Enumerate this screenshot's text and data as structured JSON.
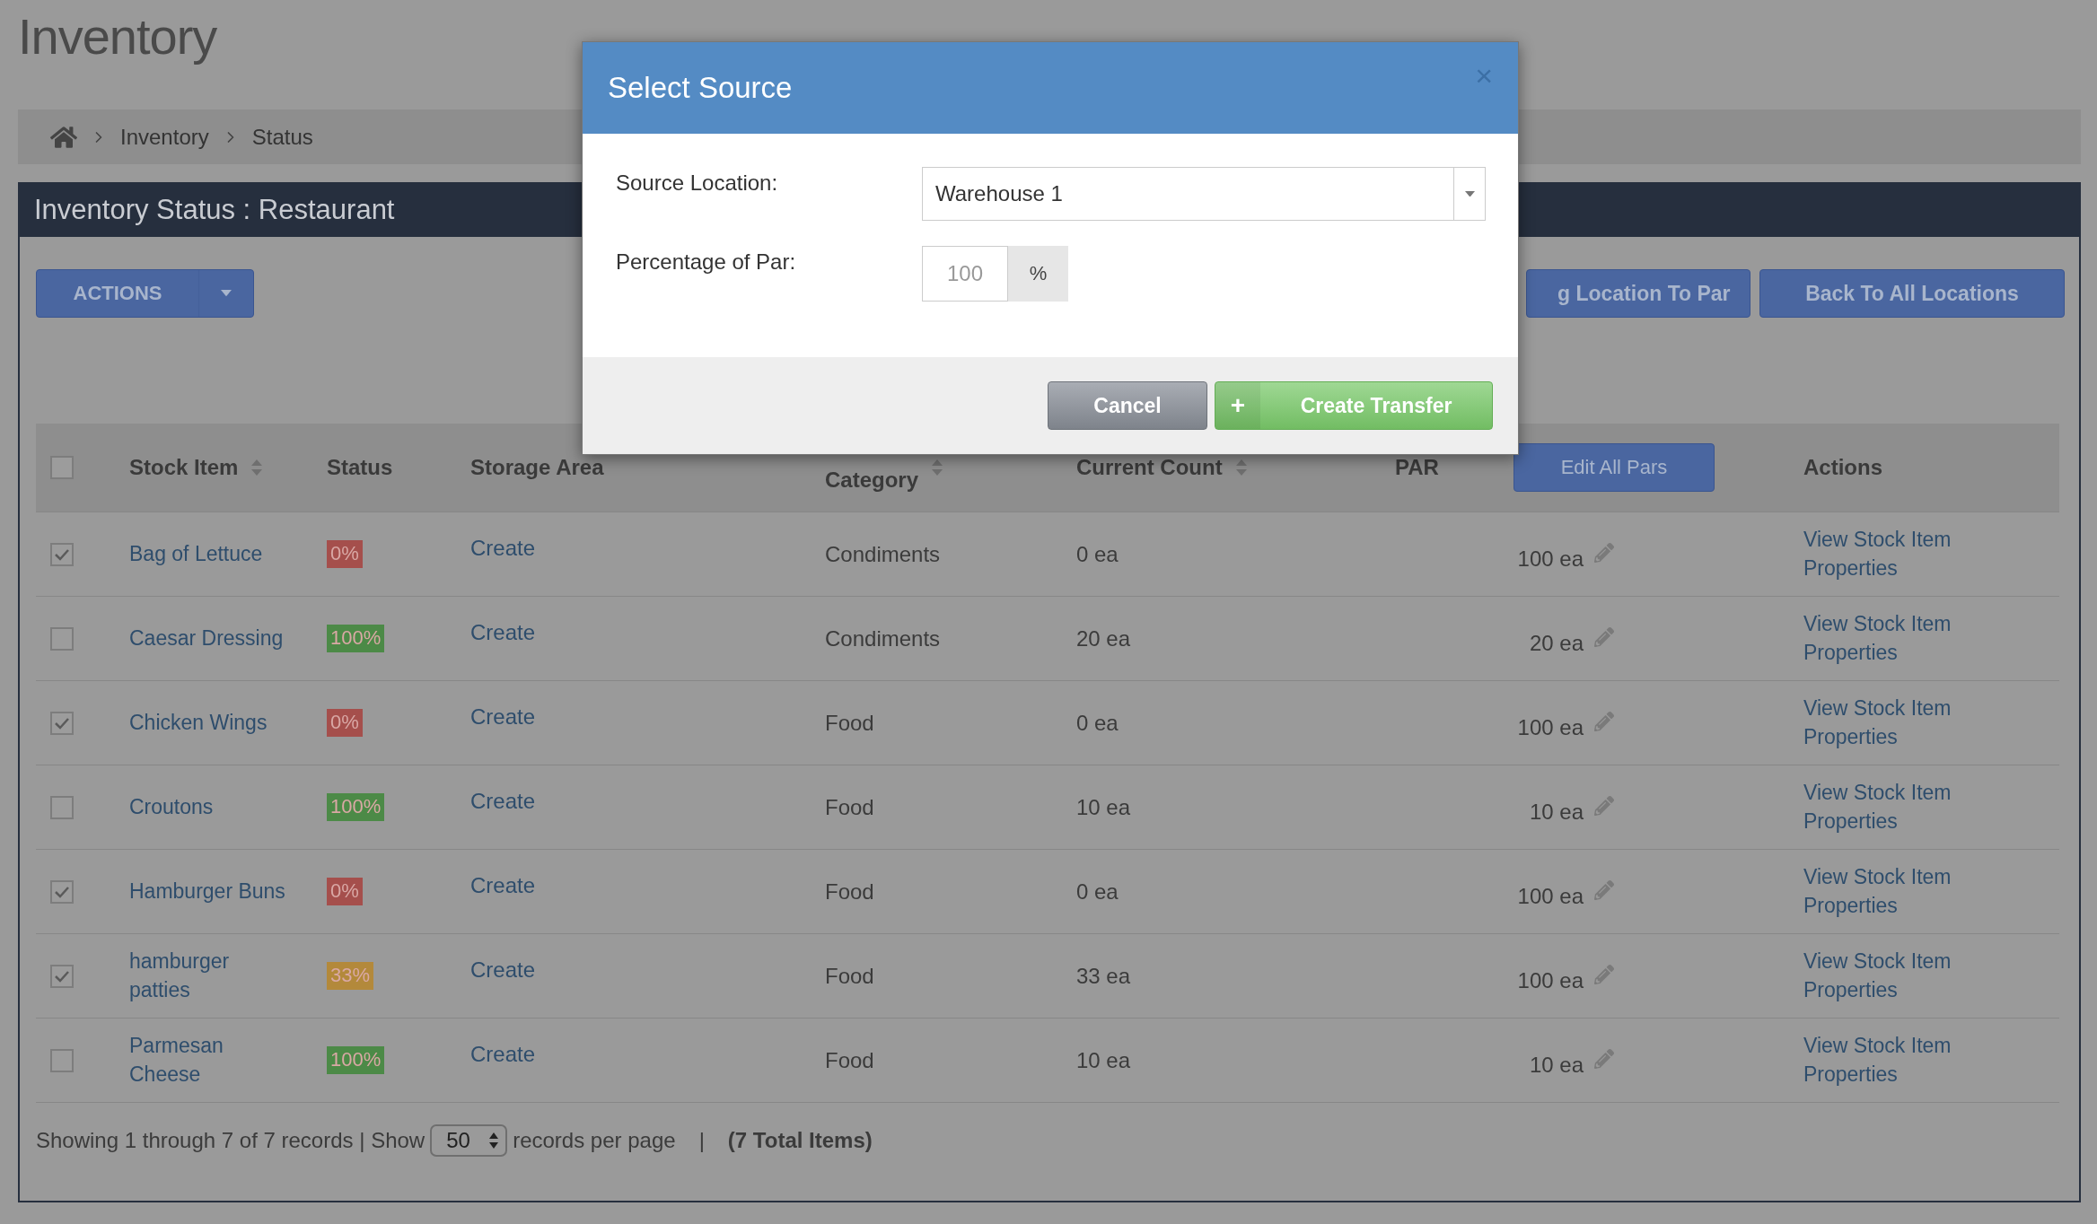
{
  "page_title": "Inventory",
  "breadcrumb": [
    "Inventory",
    "Status"
  ],
  "panel": {
    "title": "Inventory Status : Restaurant",
    "actions_button": "ACTIONS",
    "buttons": [
      "g Location To Par",
      "Back To All Locations"
    ],
    "table": {
      "select_all": {
        "checked": false
      },
      "columns": [
        {
          "label": "Stock Item",
          "sortable": true
        },
        {
          "label": "Status",
          "sortable": false
        },
        {
          "label": "Storage Area",
          "sortable": false
        },
        {
          "label": "Category",
          "sortable": true
        },
        {
          "label": "Current Count",
          "sortable": true
        },
        {
          "label": "PAR",
          "sortable": false
        },
        {
          "label": "Actions",
          "sortable": false
        }
      ],
      "edit_all_button": "Edit All Pars",
      "rows": [
        {
          "checked": true,
          "name": "Bag of Lettuce",
          "status": "0%",
          "color": "#a54f4c",
          "storage_area": "Create",
          "category": "Condiments",
          "current_count": "0 ea",
          "par": "100 ea",
          "action": "View Stock Item Properties"
        },
        {
          "checked": false,
          "name": "Caesar Dressing",
          "status": "100%",
          "color": "#4c8a47",
          "storage_area": "Create",
          "category": "Condiments",
          "current_count": "20 ea",
          "par": "20 ea",
          "action": "View Stock Item Properties"
        },
        {
          "checked": true,
          "name": "Chicken Wings",
          "status": "0%",
          "color": "#a54f4c",
          "storage_area": "Create",
          "category": "Food",
          "current_count": "0 ea",
          "par": "100 ea",
          "action": "View Stock Item Properties"
        },
        {
          "checked": false,
          "name": "Croutons",
          "status": "100%",
          "color": "#4c8a47",
          "storage_area": "Create",
          "category": "Food",
          "current_count": "10 ea",
          "par": "10 ea",
          "action": "View Stock Item Properties"
        },
        {
          "checked": true,
          "name": "Hamburger Buns",
          "status": "0%",
          "color": "#a54f4c",
          "storage_area": "Create",
          "category": "Food",
          "current_count": "0 ea",
          "par": "100 ea",
          "action": "View Stock Item Properties"
        },
        {
          "checked": true,
          "name": "hamburger patties",
          "status": "33%",
          "color": "#b3893b",
          "storage_area": "Create",
          "category": "Food",
          "current_count": "33 ea",
          "par": "100 ea",
          "action": "View Stock Item Properties"
        },
        {
          "checked": false,
          "name": "Parmesan Cheese",
          "status": "100%",
          "color": "#4c8a47",
          "storage_area": "Create",
          "category": "Food",
          "current_count": "10 ea",
          "par": "10 ea",
          "action": "View Stock Item Properties"
        }
      ]
    },
    "footer": {
      "showing": "Showing 1 through 7 of 7 records | Show",
      "page_size": "50",
      "per_page": "records per page",
      "separator": "|",
      "total": "(7 Total Items)"
    }
  },
  "modal": {
    "title": "Select Source",
    "close": "×",
    "fields": [
      {
        "kind": "select",
        "label": "Source Location:",
        "value": "Warehouse 1"
      },
      {
        "kind": "addon",
        "label": "Percentage of Par:",
        "placeholder": "100",
        "addon": "%"
      }
    ],
    "buttons": [
      {
        "kind": "default",
        "label": "Cancel"
      },
      {
        "kind": "primary",
        "icon": "+",
        "label": "Create Transfer"
      }
    ]
  }
}
